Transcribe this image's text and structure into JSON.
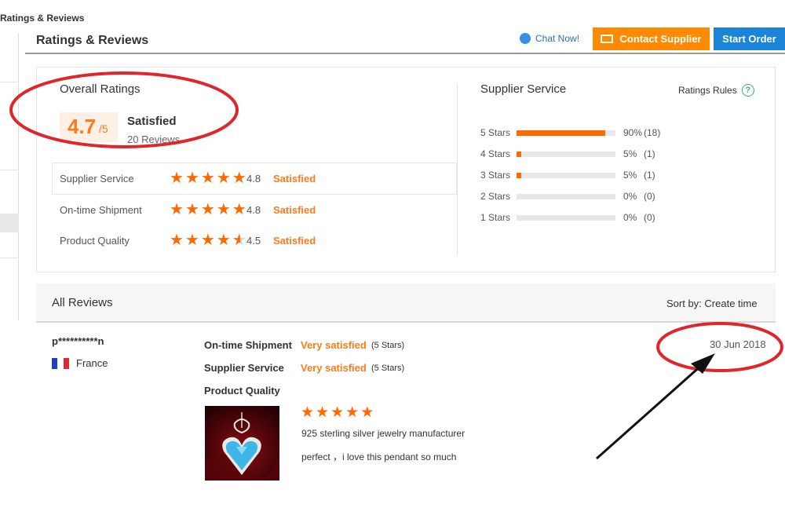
{
  "breadcrumb": "Ratings & Reviews",
  "header": {
    "title": "Ratings & Reviews",
    "chat_label": "Chat Now!",
    "contact_label": "Contact Supplier",
    "start_label": "Start Order"
  },
  "overall": {
    "title": "Overall Ratings",
    "score": "4.7",
    "out_of": "/5",
    "verdict": "Satisfied",
    "reviews": "20 Reviews",
    "rows": [
      {
        "label": "Supplier Service",
        "value": "4.8",
        "stars": 4.8,
        "verdict": "Satisfied"
      },
      {
        "label": "On-time Shipment",
        "value": "4.8",
        "stars": 4.8,
        "verdict": "Satisfied"
      },
      {
        "label": "Product Quality",
        "value": "4.5",
        "stars": 4.5,
        "verdict": "Satisfied"
      }
    ]
  },
  "supplier_service": {
    "title": "Supplier Service",
    "rules_label": "Ratings Rules",
    "bars": [
      {
        "label": "5 Stars",
        "pct": "90%",
        "count": "(18)",
        "fraction": 0.9
      },
      {
        "label": "4 Stars",
        "pct": "5%",
        "count": "(1)",
        "fraction": 0.05
      },
      {
        "label": "3 Stars",
        "pct": "5%",
        "count": "(1)",
        "fraction": 0.05
      },
      {
        "label": "2 Stars",
        "pct": "0%",
        "count": "(0)",
        "fraction": 0
      },
      {
        "label": "1 Stars",
        "pct": "0%",
        "count": "(0)",
        "fraction": 0
      }
    ]
  },
  "all_reviews": {
    "title": "All Reviews",
    "sort_label": "Sort by: Create time"
  },
  "review": {
    "user": "p**********n",
    "country": "France",
    "date": "30 Jun 2018",
    "shipment_label": "On-time Shipment",
    "shipment_value": "Very satisfied",
    "shipment_stars": "(5 Stars)",
    "service_label": "Supplier Service",
    "service_value": "Very satisfied",
    "service_stars": "(5 Stars)",
    "quality_label": "Product Quality",
    "product_stars": 5,
    "product_name": "925 sterling silver jewelry manufacturer",
    "comment": "perfect ，i love this pendant so much"
  },
  "colors": {
    "accent": "#ff6a00",
    "contact_button": "#ff8a00",
    "start_button": "#1a84d8",
    "annotation": "#e0252b"
  }
}
